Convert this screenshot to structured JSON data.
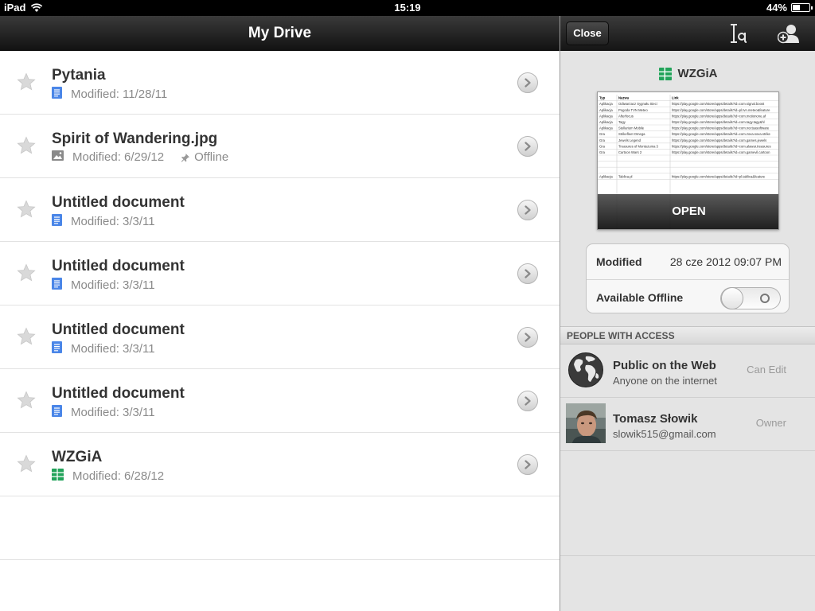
{
  "status": {
    "device": "iPad",
    "time": "15:19",
    "battery": "44%",
    "battery_fraction": 0.44
  },
  "drive": {
    "title": "My Drive",
    "files": [
      {
        "title": "Pytania",
        "meta": "Modified: 11/28/11",
        "type": "document"
      },
      {
        "title": "Spirit of Wandering.jpg",
        "meta": "Modified: 6/29/12",
        "type": "image",
        "offline_label": "Offline"
      },
      {
        "title": "Untitled document",
        "meta": "Modified: 3/3/11",
        "type": "document"
      },
      {
        "title": "Untitled document",
        "meta": "Modified: 3/3/11",
        "type": "document"
      },
      {
        "title": "Untitled document",
        "meta": "Modified: 3/3/11",
        "type": "document"
      },
      {
        "title": "Untitled document",
        "meta": "Modified: 3/3/11",
        "type": "document"
      },
      {
        "title": "WZGiA",
        "meta": "Modified: 6/28/12",
        "type": "spreadsheet"
      }
    ]
  },
  "details": {
    "close_label": "Close",
    "title": "WZGiA",
    "open_label": "OPEN",
    "modified_label": "Modified",
    "modified_value": "28 cze 2012 09:07 PM",
    "offline_label": "Available Offline",
    "offline_enabled": false,
    "access_header": "PEOPLE WITH ACCESS",
    "people": [
      {
        "name": "Public on the Web",
        "sub": "Anyone on the internet",
        "role": "Can Edit"
      },
      {
        "name": "Tomasz Słowik",
        "sub": "slowik515@gmail.com",
        "role": "Owner"
      }
    ]
  },
  "preview_sheet": {
    "headers": [
      "Typ",
      "Nazwa",
      "Link"
    ],
    "rows": [
      [
        "Aplikacja",
        "Odtwarzacz Sygnału Sieci",
        "https://play.google.com/store/apps/details?id=com.signal.boost"
      ],
      [
        "Aplikacja",
        "Pogoda TVN Meteo",
        "https://play.google.com/store/apps/details?id=pl.tvn.meteo&feature"
      ],
      [
        "Aplikacja",
        "Afterfocus",
        "https://play.google.com/store/apps/details?id=com.motionone.af"
      ],
      [
        "Aplikacja",
        "Tagy",
        "https://play.google.com/store/apps/details?id=com.tagy.tagy&hl"
      ],
      [
        "Aplikacja",
        "Stellarium Mobile",
        "https://play.google.com/store/apps/details?id=com.noctuasoftware"
      ],
      [
        "Gra",
        "Strikefleet Omega",
        "https://play.google.com/store/apps/details?id=com.zova.sova.strike"
      ],
      [
        "Gra",
        "Jewels Legend",
        "https://play.google.com/store/apps/details?id=com.games.jewels"
      ],
      [
        "Gra",
        "Treasures of Montezuma 3",
        "https://play.google.com/store/apps/details?id=com.alawar.treasures"
      ],
      [
        "Gra",
        "Cartoon Wars 2",
        "https://play.google.com/store/apps/details?id=com.gamevil.cartoon"
      ],
      [
        "",
        "",
        ""
      ],
      [
        "",
        "",
        ""
      ],
      [
        "",
        "",
        ""
      ],
      [
        "Aplikacja",
        "Tablica.pl",
        "https://play.google.com/store/apps/details?id=pl.tablica&feature"
      ]
    ]
  },
  "colors": {
    "doc_blue": "#4a86e8",
    "sheet_green": "#22a35a",
    "navbar_dark": "#1c1c1c"
  }
}
